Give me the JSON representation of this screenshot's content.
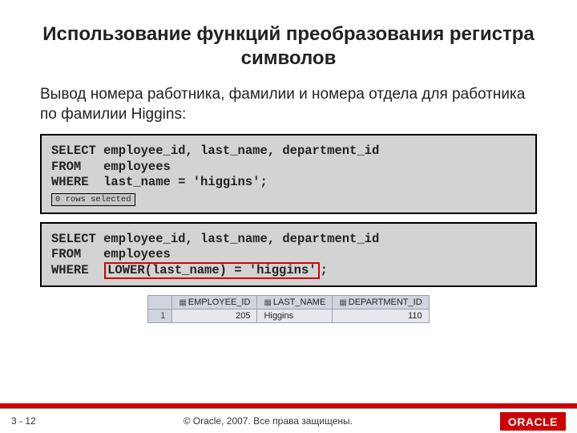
{
  "title": "Использование функций преобразования регистра символов",
  "description": "Вывод номера работника, фамилии и номера отдела для работника по фамилии Higgins:",
  "code1": {
    "line1": "SELECT employee_id, last_name, department_id",
    "line2": "FROM   employees",
    "line3": "WHERE  last_name = 'higgins';",
    "rows_note": "0 rows selected"
  },
  "code2": {
    "line1": "SELECT employee_id, last_name, department_id",
    "line2": "FROM   employees",
    "where_kw": "WHERE  ",
    "highlight": "LOWER(last_name) = 'higgins'",
    "semicolon": ";"
  },
  "result": {
    "columns": [
      "EMPLOYEE_ID",
      "LAST_NAME",
      "DEPARTMENT_ID"
    ],
    "row": {
      "num": "1",
      "emp": "205",
      "name": "Higgins",
      "dept": "110"
    }
  },
  "footer": {
    "page": "3 - 12",
    "copyright": "© Oracle, 2007. Все права защищены.",
    "logo": "ORACLE"
  }
}
